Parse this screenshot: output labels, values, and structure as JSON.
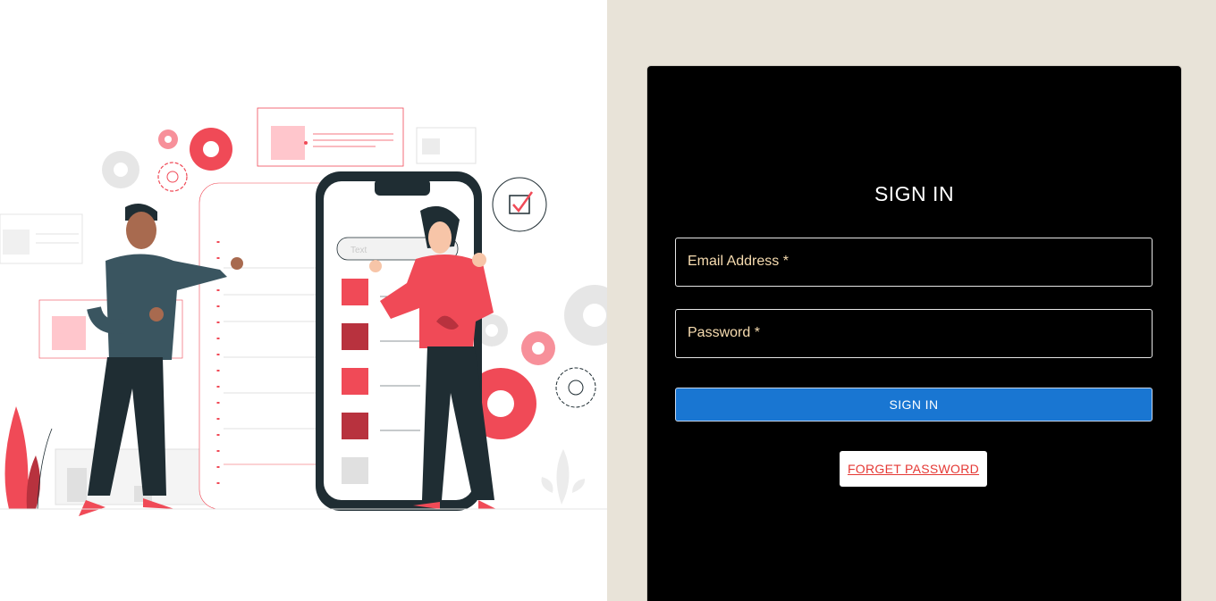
{
  "login": {
    "title": "SIGN IN",
    "email_label": "Email Address *",
    "password_label": "Password *",
    "submit_label": "SIGN IN",
    "forget_label": "FORGET PASSWORD"
  },
  "illustration": {
    "phone_search_placeholder": "Text"
  },
  "colors": {
    "accent_red": "#f04a57",
    "dark_red": "#b8323e",
    "button_blue": "#1976d2",
    "panel_bg": "#e8e3d8",
    "card_bg": "#000000",
    "label_color": "#f7dcb0",
    "dark_navy": "#1f2d33"
  }
}
